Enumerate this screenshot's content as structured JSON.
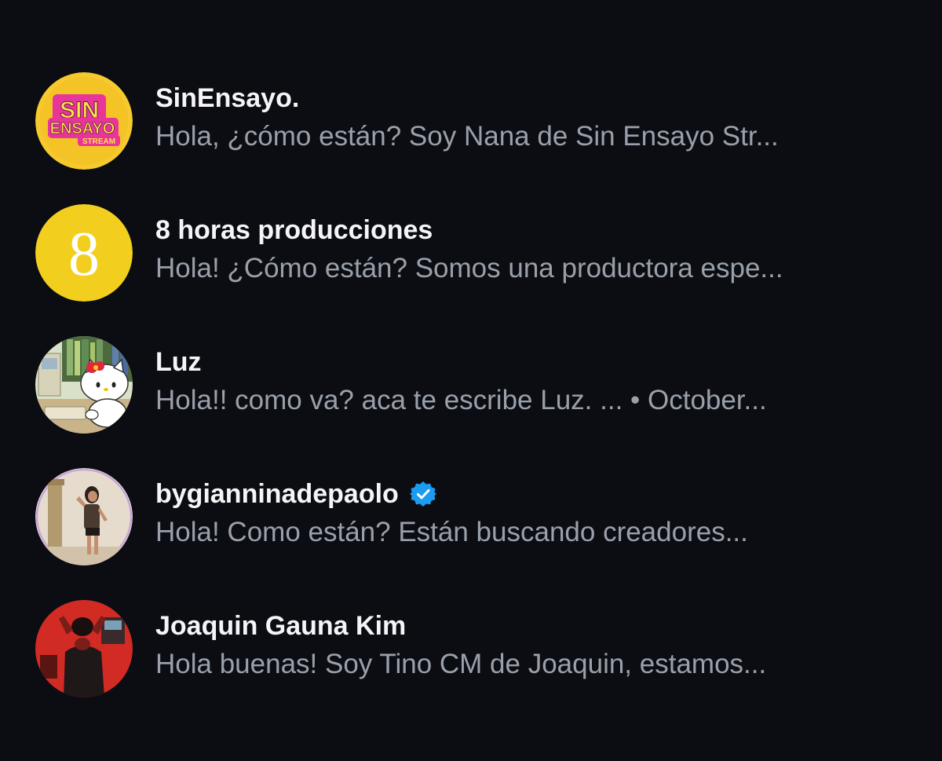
{
  "conversations": [
    {
      "name": "SinEnsayo.",
      "preview": "Hola, ¿cómo están? Soy Nana de Sin Ensayo Str...",
      "verified": false,
      "avatar": {
        "kind": "logo",
        "lines": [
          "SIN",
          "ENSAYO",
          "STREAM"
        ],
        "bg": "#f6c92e",
        "accent": "#e8359a"
      }
    },
    {
      "name": "8 horas producciones",
      "preview": "Hola! ¿Cómo están? Somos una productora espe...",
      "verified": false,
      "avatar": {
        "kind": "logo",
        "lines": [
          "8"
        ],
        "bg": "#f2cf1f"
      }
    },
    {
      "name": "Luz",
      "preview": "Hola!! como va? aca te escribe Luz. ... • October...",
      "verified": false,
      "avatar": {
        "kind": "illustration",
        "subject": "hello-kitty-at-computer"
      }
    },
    {
      "name": "bygianninadepaolo",
      "preview": "Hola! Como están? Están buscando creadores...",
      "verified": true,
      "avatar": {
        "kind": "photo",
        "subject": "woman-posing"
      }
    },
    {
      "name": "Joaquin Gauna Kim",
      "preview": "Hola buenas! Soy Tino CM de Joaquin, estamos...",
      "verified": false,
      "avatar": {
        "kind": "photo",
        "subject": "person-red-lit-room"
      }
    }
  ],
  "colors": {
    "background": "#0b0d12",
    "name": "#f5f5f7",
    "preview": "#9aa0ab",
    "verified": "#1d9bf0"
  }
}
